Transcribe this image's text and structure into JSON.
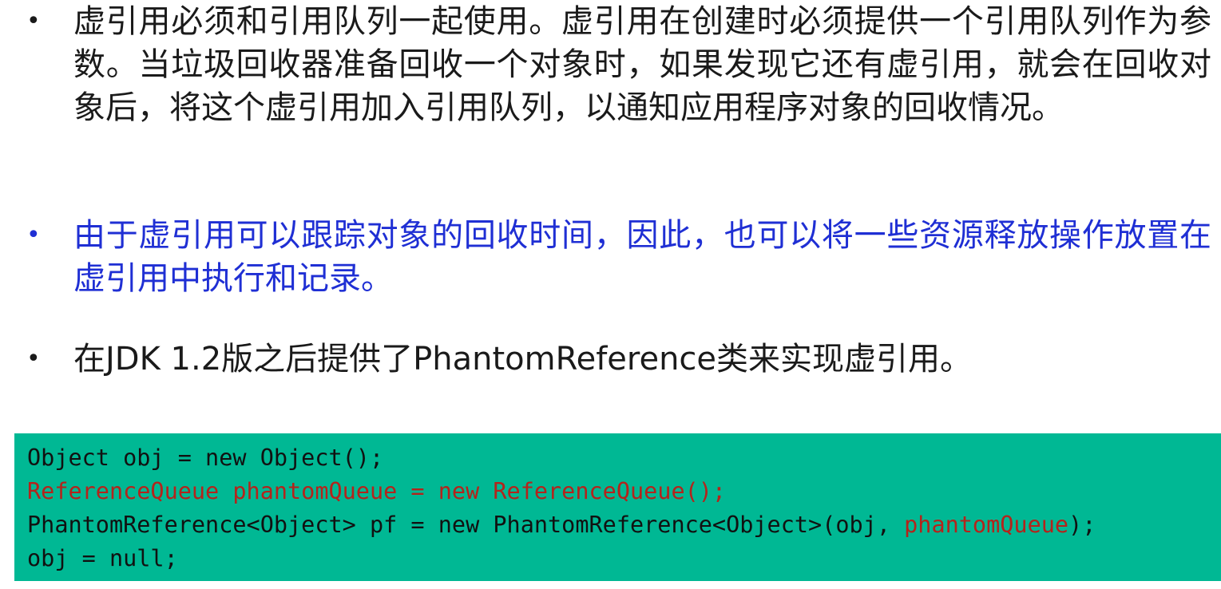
{
  "bullets": [
    {
      "dot": "•",
      "text": "虚引用必须和引用队列一起使用。虚引用在创建时必须提供一个引用队列作为参数。当垃圾回收器准备回收一个对象时，如果发现它还有虚引用，就会在回收对象后，将这个虚引用加入引用队列，以通知应用程序对象的回收情况。"
    },
    {
      "dot": "•",
      "text": "由于虚引用可以跟踪对象的回收时间，因此，也可以将一些资源释放操作放置在虚引用中执行和记录。"
    },
    {
      "dot": "•",
      "text": "在JDK 1.2版之后提供了PhantomReference类来实现虚引用。"
    }
  ],
  "code": {
    "line1": "Object obj = new Object();",
    "line2": "ReferenceQueue phantomQueue = new ReferenceQueue();",
    "line3_a": "PhantomReference<Object> pf = new PhantomReference<Object>(obj, ",
    "line3_b": "phantomQueue",
    "line3_c": ");",
    "line4": "obj = null;"
  },
  "colors": {
    "blue_text": "#1f2fd4",
    "code_background": "#00b894",
    "code_highlight": "#b5231b"
  }
}
